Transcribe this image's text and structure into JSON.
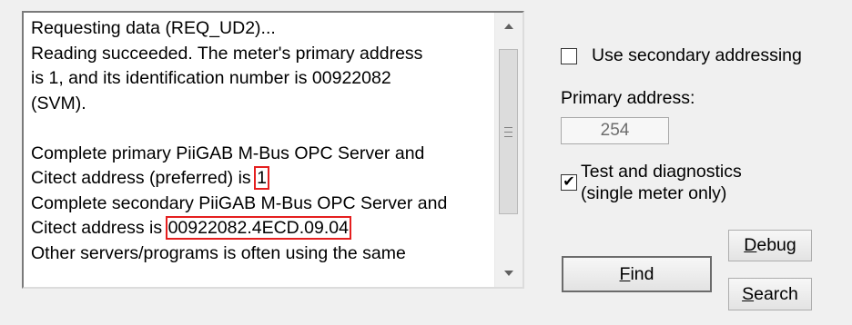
{
  "log": {
    "lines": [
      {
        "text": "Requesting data (REQ_UD2)..."
      },
      {
        "text": "Reading succeeded. The meter's primary address"
      },
      {
        "text": "is 1, and its identification number is 00922082"
      },
      {
        "text": "(SVM)."
      },
      {
        "text": ""
      },
      {
        "text": "Complete primary PiiGAB M-Bus OPC Server and"
      },
      {
        "prefix": "Citect address (preferred) is ",
        "highlight": "1"
      },
      {
        "text": "Complete secondary PiiGAB M-Bus OPC Server and"
      },
      {
        "prefix": "Citect address is ",
        "highlight": "00922082.4ECD.09.04"
      },
      {
        "text": "Other servers/programs is often using the same"
      }
    ],
    "highlight_color": "#e51f1f"
  },
  "options": {
    "secondary_addressing": {
      "label": "Use secondary addressing",
      "checked": false
    },
    "primary_address": {
      "label": "Primary address:",
      "value": "254"
    },
    "test_diagnostics": {
      "label_line1": "Test and diagnostics",
      "label_line2": "(single meter only)",
      "checked": true
    }
  },
  "buttons": {
    "find": {
      "mnemonic": "F",
      "rest": "ind"
    },
    "debug": {
      "mnemonic": "D",
      "rest": "ebug"
    },
    "search": {
      "mnemonic": "S",
      "rest": "earch"
    }
  },
  "icons": {
    "scroll_up": "arrow-up-icon",
    "scroll_down": "arrow-down-icon",
    "thumb_grip": "grip-icon",
    "checkmark": "check-icon"
  }
}
